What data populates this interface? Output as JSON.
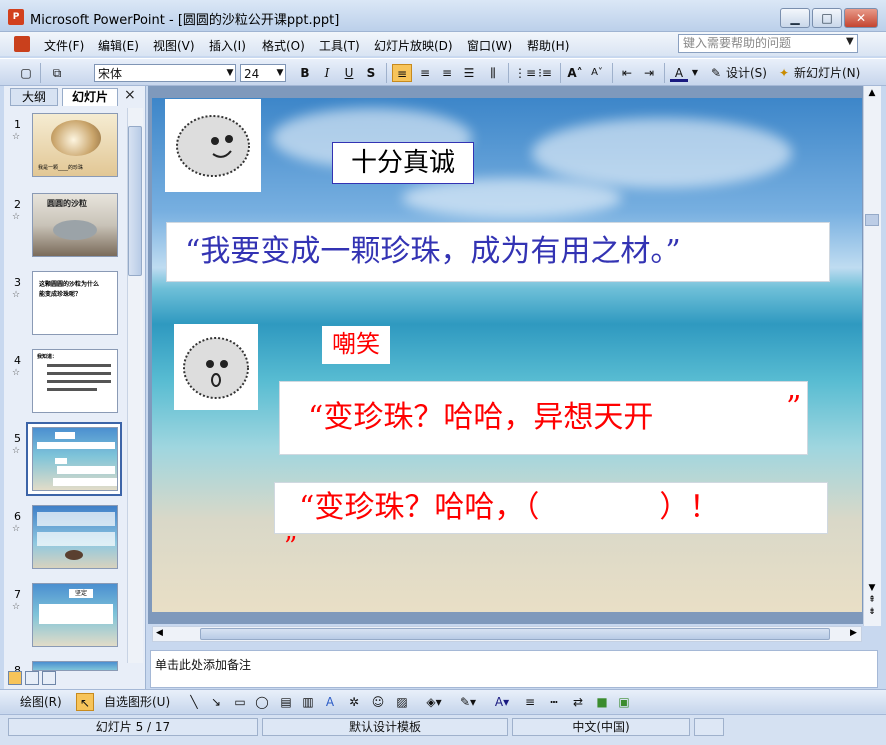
{
  "window": {
    "title": "Microsoft PowerPoint - [圆圆的沙粒公开课ppt.ppt]",
    "app_icon": "P"
  },
  "menu": {
    "items": [
      "文件(F)",
      "编辑(E)",
      "视图(V)",
      "插入(I)",
      "格式(O)",
      "工具(T)",
      "幻灯片放映(D)",
      "窗口(W)",
      "帮助(H)"
    ],
    "help_placeholder": "键入需要帮助的问题"
  },
  "toolbar": {
    "font_name": "宋体",
    "font_size": "24",
    "bold": "B",
    "italic": "I",
    "underline": "U",
    "shadow": "S",
    "design_label": "设计(S)",
    "new_slide_label": "新幻灯片(N)"
  },
  "panel": {
    "tab_outline": "大纲",
    "tab_slides": "幻灯片",
    "close": "×",
    "slides": [
      {
        "num": "1",
        "caption": "我是一颗____的珍珠"
      },
      {
        "num": "2",
        "caption": "圆圆的沙粒"
      },
      {
        "num": "3",
        "caption": "这颗圆圆的沙粒为什么能变成珍珠呢？"
      },
      {
        "num": "4",
        "caption": "我知道："
      },
      {
        "num": "5",
        "caption": ""
      },
      {
        "num": "6",
        "caption": ""
      },
      {
        "num": "7",
        "caption": "坚定"
      },
      {
        "num": "8",
        "caption": ""
      }
    ],
    "selected_index": 4
  },
  "slide": {
    "label_sincere": "十分真诚",
    "quote_pearl": "“我要变成一颗珍珠，成为有用之材。”",
    "label_mock": "嘲笑",
    "quote_mock_1_main": "“变珍珠？哈哈，异想天开",
    "quote_mock_1_end": "”",
    "quote_mock_2_main": "“变珍珠？哈哈，（　　　　）！",
    "quote_mock_2_end": "”"
  },
  "notes": {
    "placeholder": "单击此处添加备注"
  },
  "drawbar": {
    "draw_label": "绘图(R)",
    "autoshape_label": "自选图形(U)"
  },
  "status": {
    "slide_counter": "幻灯片 5 / 17",
    "template": "默认设计模板",
    "language": "中文(中国)"
  },
  "colors": {
    "accent_blue": "#3333b3",
    "accent_red": "#ff0000"
  }
}
